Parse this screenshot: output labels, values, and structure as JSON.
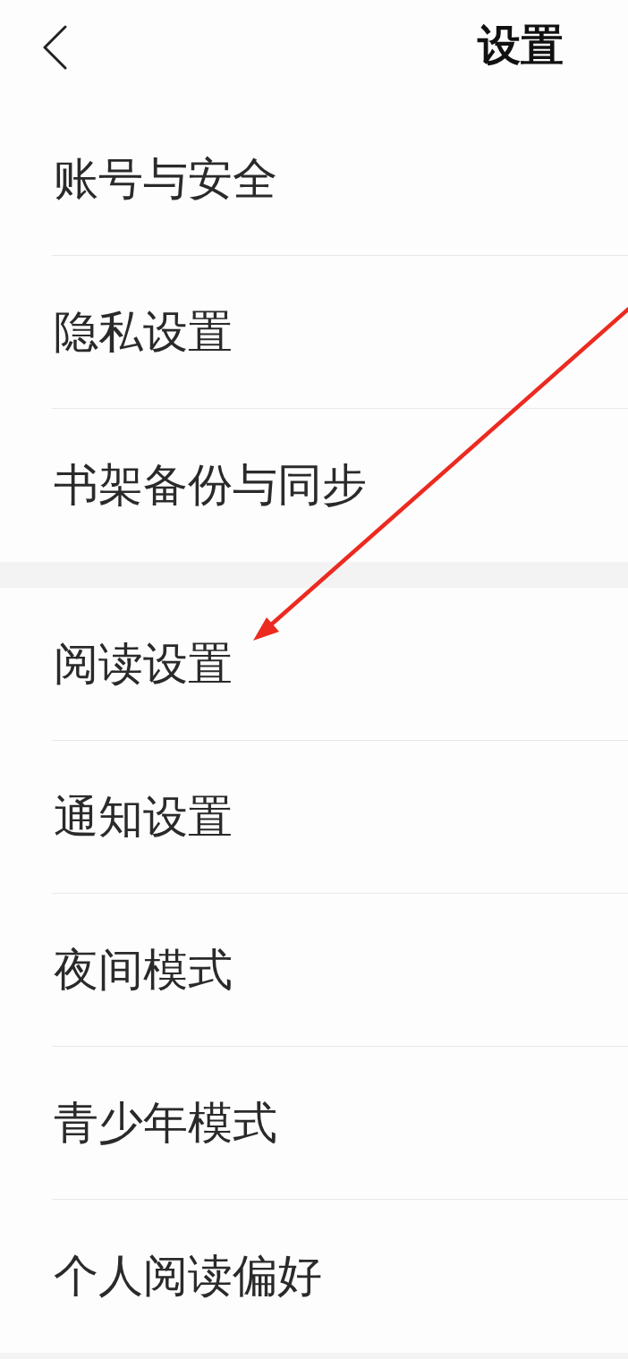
{
  "header": {
    "title": "设置"
  },
  "sections": [
    {
      "items": [
        {
          "label": "账号与安全"
        },
        {
          "label": "隐私设置"
        },
        {
          "label": "书架备份与同步"
        }
      ]
    },
    {
      "items": [
        {
          "label": "阅读设置"
        },
        {
          "label": "通知设置"
        },
        {
          "label": "夜间模式"
        },
        {
          "label": "青少年模式"
        },
        {
          "label": "个人阅读偏好"
        }
      ]
    }
  ]
}
